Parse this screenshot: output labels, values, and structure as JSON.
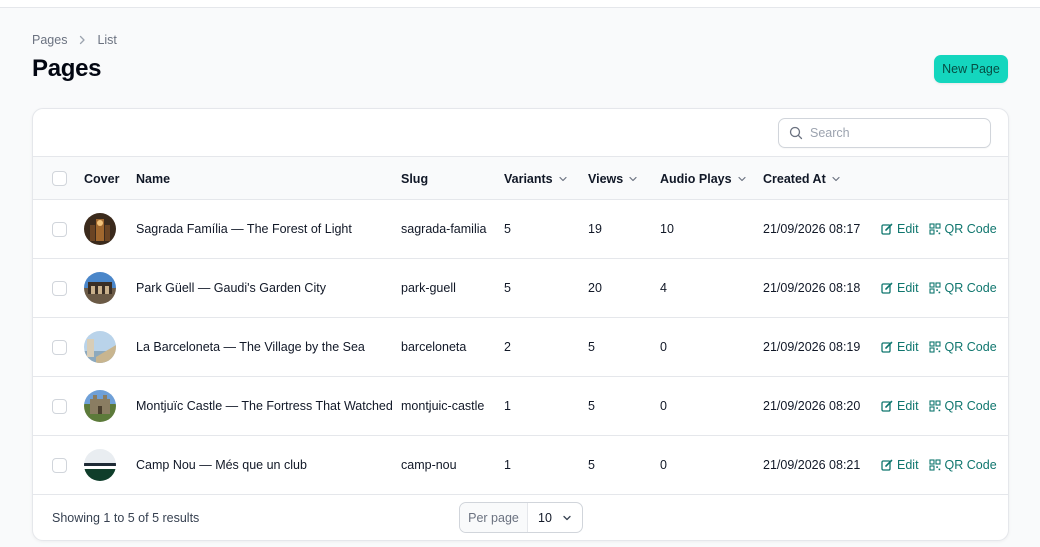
{
  "breadcrumb": {
    "root": "Pages",
    "current": "List"
  },
  "page_title": "Pages",
  "new_page_label": "New Page",
  "search": {
    "placeholder": "Search",
    "value": ""
  },
  "columns": {
    "cover": "Cover",
    "name": "Name",
    "slug": "Slug",
    "variants": "Variants",
    "views": "Views",
    "audio_plays": "Audio Plays",
    "created_at": "Created At"
  },
  "actions": {
    "edit": "Edit",
    "qr": "QR Code"
  },
  "rows": [
    {
      "name": "Sagrada Família — The Forest of Light",
      "slug": "sagrada-familia",
      "variants": "5",
      "views": "19",
      "audio_plays": "10",
      "created_at": "21/09/2026 08:17"
    },
    {
      "name": "Park Güell — Gaudi's Garden City",
      "slug": "park-guell",
      "variants": "5",
      "views": "20",
      "audio_plays": "4",
      "created_at": "21/09/2026 08:18"
    },
    {
      "name": "La Barceloneta — The Village by the Sea",
      "slug": "barceloneta",
      "variants": "2",
      "views": "5",
      "audio_plays": "0",
      "created_at": "21/09/2026 08:19"
    },
    {
      "name": "Montjuïc Castle — The Fortress That Watched",
      "slug": "montjuic-castle",
      "variants": "1",
      "views": "5",
      "audio_plays": "0",
      "created_at": "21/09/2026 08:20"
    },
    {
      "name": "Camp Nou — Més que un club",
      "slug": "camp-nou",
      "variants": "1",
      "views": "5",
      "audio_plays": "0",
      "created_at": "21/09/2026 08:21"
    }
  ],
  "footer": {
    "results_text": "Showing 1 to 5 of 5 results",
    "per_page_label": "Per page",
    "per_page_value": "10"
  },
  "colors": {
    "accent": "#14d6be",
    "link": "#0f766e"
  },
  "icons": {
    "breadcrumb_separator": "chevron-right-icon",
    "search": "search-icon",
    "sort": "chevron-down-icon",
    "edit": "edit-icon",
    "qr": "qr-code-icon"
  }
}
